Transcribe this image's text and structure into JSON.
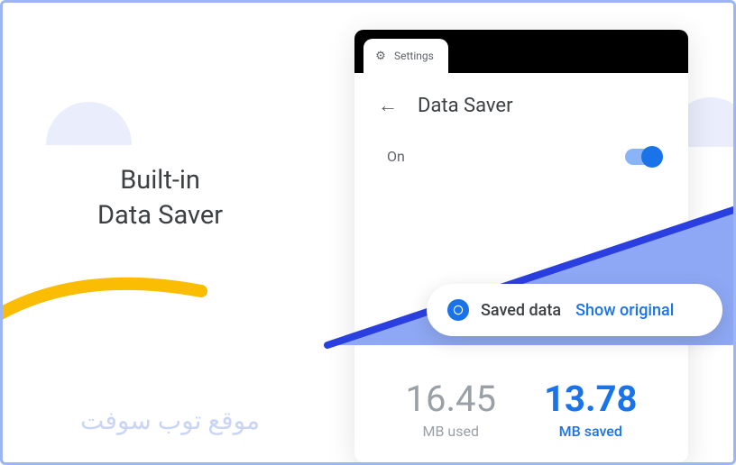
{
  "headline_line1": "Built-in",
  "headline_line2": "Data Saver",
  "watermark": "موقع توب سوفت",
  "tab": {
    "label": "Settings"
  },
  "screen": {
    "title": "Data Saver",
    "toggle_label": "On"
  },
  "pill": {
    "saved_text": "Saved data",
    "show_original": "Show original"
  },
  "stats": {
    "used_value": "16.45",
    "used_label": "MB used",
    "saved_value": "13.78",
    "saved_label": "MB saved"
  },
  "colors": {
    "accent": "#1a73e8",
    "border": "#9db4f5",
    "muted": "#9aa0a6"
  }
}
